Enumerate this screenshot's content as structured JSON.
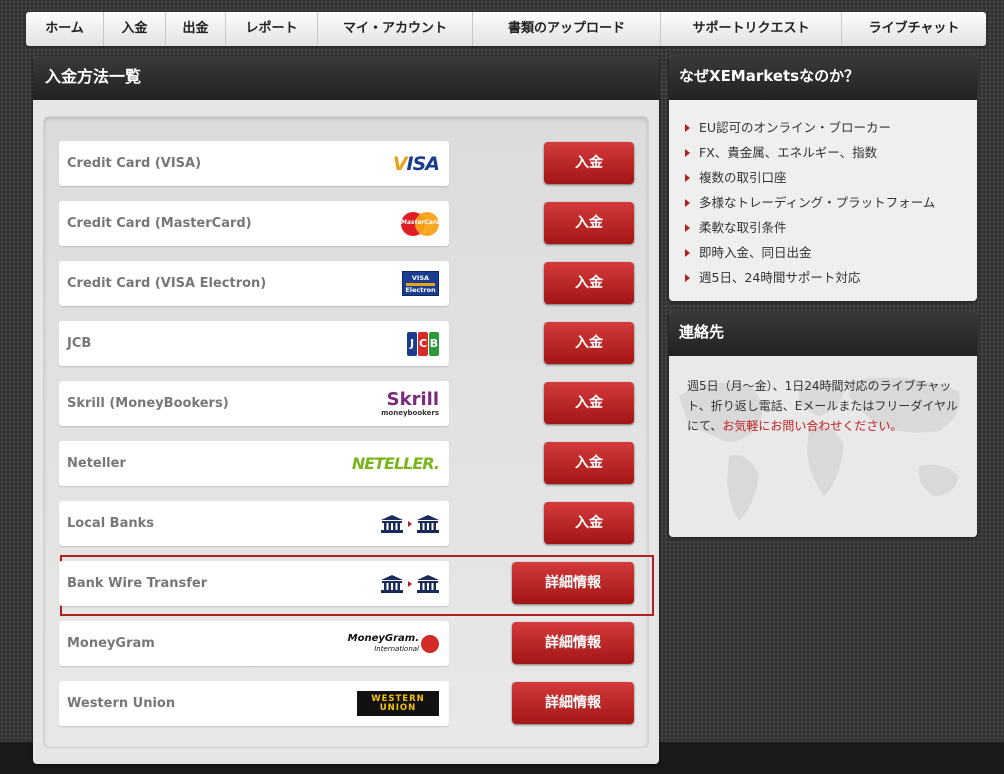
{
  "nav": {
    "items": [
      {
        "label": "ホーム",
        "w": 78
      },
      {
        "label": "入金",
        "w": 62
      },
      {
        "label": "出金",
        "w": 60
      },
      {
        "label": "レポート",
        "w": 92
      },
      {
        "label": "マイ・アカウント",
        "w": 155
      },
      {
        "label": "書類のアップロード",
        "w": 188
      },
      {
        "label": "サポートリクエスト",
        "w": 181
      },
      {
        "label": "ライブチャット",
        "w": 144
      }
    ]
  },
  "deposit_panel": {
    "title": "入金方法一覧",
    "methods": [
      {
        "name": "Credit Card (VISA)",
        "logo": "visa-logo",
        "button": "入金",
        "button_type": "deposit"
      },
      {
        "name": "Credit Card (MasterCard)",
        "logo": "mastercard-logo",
        "button": "入金",
        "button_type": "deposit"
      },
      {
        "name": "Credit Card (VISA Electron)",
        "logo": "visa-electron-logo",
        "button": "入金",
        "button_type": "deposit"
      },
      {
        "name": "JCB",
        "logo": "jcb-logo",
        "button": "入金",
        "button_type": "deposit"
      },
      {
        "name": "Skrill (MoneyBookers)",
        "logo": "skrill-logo",
        "button": "入金",
        "button_type": "deposit"
      },
      {
        "name": "Neteller",
        "logo": "neteller-logo",
        "button": "入金",
        "button_type": "deposit"
      },
      {
        "name": "Local Banks",
        "logo": "bank-transfer-icon",
        "button": "入金",
        "button_type": "deposit",
        "highlighted": true
      },
      {
        "name": "Bank Wire Transfer",
        "logo": "bank-transfer-icon",
        "button": "詳細情報",
        "button_type": "details"
      },
      {
        "name": "MoneyGram",
        "logo": "moneygram-logo",
        "button": "詳細情報",
        "button_type": "details"
      },
      {
        "name": "Western Union",
        "logo": "western-union-logo",
        "button": "詳細情報",
        "button_type": "details"
      }
    ]
  },
  "logos": {
    "visa": {
      "text_v": "V",
      "text_rest": "ISA"
    },
    "mastercard": {
      "text": "MasterCard"
    },
    "visa_electron": {
      "top": "VISA",
      "bottom": "Electron"
    },
    "jcb": {
      "letters": [
        "J",
        "C",
        "B"
      ],
      "colors": [
        "#1a3d8f",
        "#d32a2a",
        "#2a9a3a"
      ]
    },
    "skrill": {
      "main": "Skrill",
      "sub": "moneybookers"
    },
    "neteller": {
      "text": "NETELLER."
    },
    "moneygram": {
      "main": "MoneyGram.",
      "sub": "International"
    },
    "western_union": {
      "line1": "WESTERN",
      "line2": "UNION"
    }
  },
  "why_panel": {
    "title": "なぜXEMarketsなのか？",
    "reasons": [
      "EU認可のオンライン・ブローカー",
      "FX、貴金属、エネルギー、指数",
      "複数の取引口座",
      "多様なトレーディング・プラットフォーム",
      "柔軟な取引条件",
      "即時入金、同日出金",
      "週5日、24時間サポート対応"
    ]
  },
  "contact_panel": {
    "title": "連絡先",
    "text": "週5日（月～金）、1日24時間対応のライブチャット、折り返し電話、Eメールまたはフリーダイヤルにて、",
    "link": "お気軽にお問い合わせください。"
  },
  "colors": {
    "accent_red": "#b02020",
    "button_red": "#c22828",
    "header_dark": "#2a2a2a"
  }
}
